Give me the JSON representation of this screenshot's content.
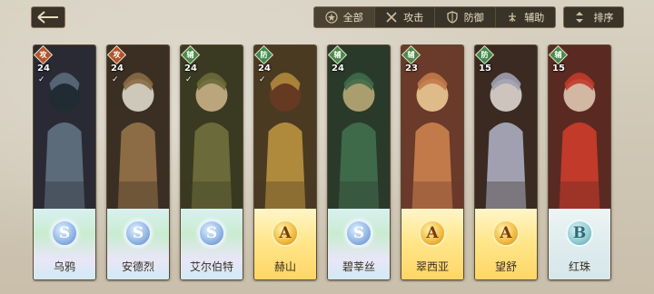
{
  "nav": {
    "back_icon": "arrow-left-icon"
  },
  "filters": [
    {
      "label": "全部",
      "icon": "star-circle-icon",
      "active": true
    },
    {
      "label": "攻击",
      "icon": "crossed-swords-icon",
      "active": false
    },
    {
      "label": "防御",
      "icon": "shield-icon",
      "active": false
    },
    {
      "label": "辅助",
      "icon": "support-icon",
      "active": false
    }
  ],
  "sort": {
    "label": "排序",
    "icon": "sort-arrows-icon"
  },
  "colors": {
    "attack": "#b4532a",
    "defense": "#3f8a4d",
    "support": "#4a8a4a",
    "accent": "#e8dcc3"
  },
  "characters": [
    {
      "name": "乌鸦",
      "role": "攻",
      "role_type": "attack",
      "level": "24",
      "rank": "S",
      "checked": true
    },
    {
      "name": "安德烈",
      "role": "攻",
      "role_type": "attack",
      "level": "24",
      "rank": "S",
      "checked": true
    },
    {
      "name": "艾尔伯特",
      "role": "辅",
      "role_type": "support",
      "level": "24",
      "rank": "S",
      "checked": true
    },
    {
      "name": "赫山",
      "role": "防",
      "role_type": "defense",
      "level": "24",
      "rank": "A",
      "checked": true
    },
    {
      "name": "碧莘丝",
      "role": "辅",
      "role_type": "support",
      "level": "24",
      "rank": "S",
      "checked": false
    },
    {
      "name": "翠西亚",
      "role": "辅",
      "role_type": "support",
      "level": "23",
      "rank": "A",
      "checked": false
    },
    {
      "name": "望舒",
      "role": "防",
      "role_type": "defense",
      "level": "15",
      "rank": "A",
      "checked": false
    },
    {
      "name": "红珠",
      "role": "辅",
      "role_type": "support",
      "level": "15",
      "rank": "B",
      "checked": false
    }
  ]
}
